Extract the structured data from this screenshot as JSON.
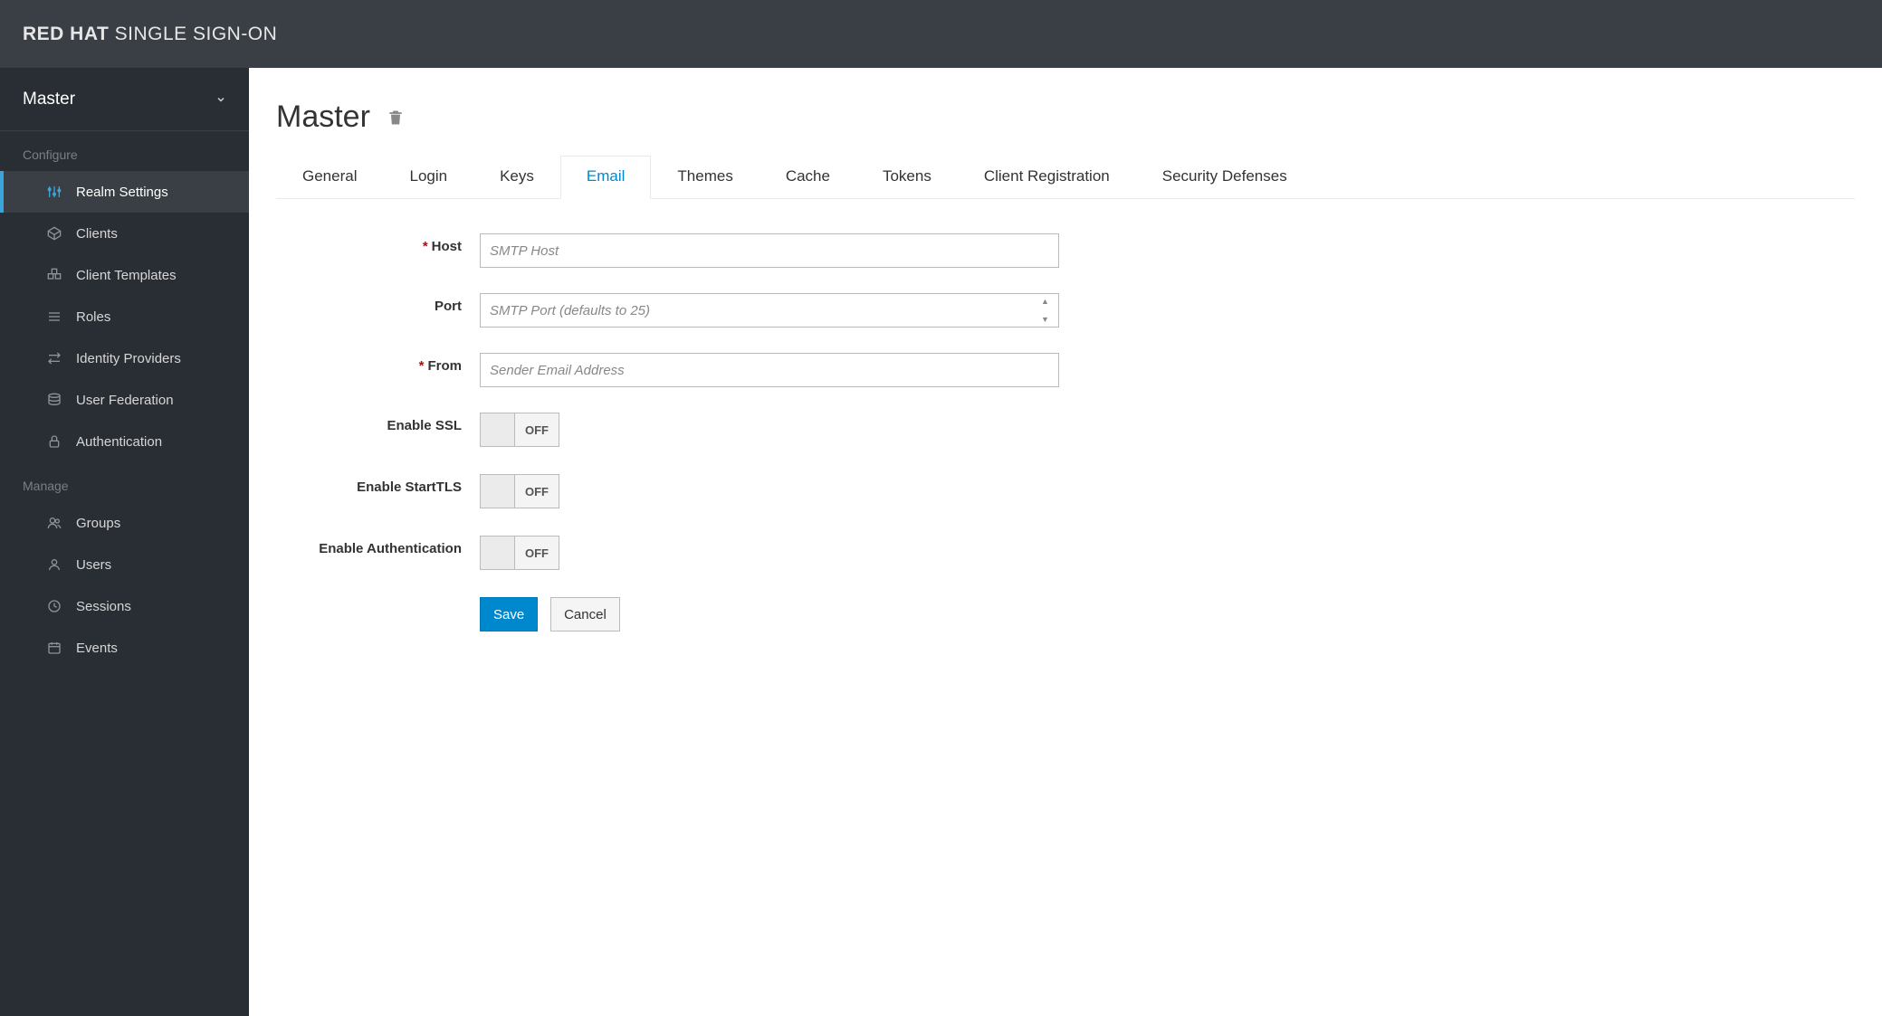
{
  "brand": {
    "bold": "RED HAT",
    "rest": " SINGLE SIGN-ON"
  },
  "realm_selector": {
    "label": "Master"
  },
  "sidebar": {
    "configure_title": "Configure",
    "manage_title": "Manage",
    "configure": [
      {
        "label": "Realm Settings",
        "active": true
      },
      {
        "label": "Clients"
      },
      {
        "label": "Client Templates"
      },
      {
        "label": "Roles"
      },
      {
        "label": "Identity Providers"
      },
      {
        "label": "User Federation"
      },
      {
        "label": "Authentication"
      }
    ],
    "manage": [
      {
        "label": "Groups"
      },
      {
        "label": "Users"
      },
      {
        "label": "Sessions"
      },
      {
        "label": "Events"
      }
    ]
  },
  "page": {
    "title": "Master"
  },
  "tabs": [
    {
      "label": "General"
    },
    {
      "label": "Login"
    },
    {
      "label": "Keys"
    },
    {
      "label": "Email",
      "active": true
    },
    {
      "label": "Themes"
    },
    {
      "label": "Cache"
    },
    {
      "label": "Tokens"
    },
    {
      "label": "Client Registration"
    },
    {
      "label": "Security Defenses"
    }
  ],
  "form": {
    "host_label": "Host",
    "host_placeholder": "SMTP Host",
    "host_value": "",
    "port_label": "Port",
    "port_placeholder": "SMTP Port (defaults to 25)",
    "port_value": "",
    "from_label": "From",
    "from_placeholder": "Sender Email Address",
    "from_value": "",
    "enable_ssl_label": "Enable SSL",
    "enable_ssl_value": "OFF",
    "enable_starttls_label": "Enable StartTLS",
    "enable_starttls_value": "OFF",
    "enable_auth_label": "Enable Authentication",
    "enable_auth_value": "OFF",
    "save_label": "Save",
    "cancel_label": "Cancel"
  }
}
